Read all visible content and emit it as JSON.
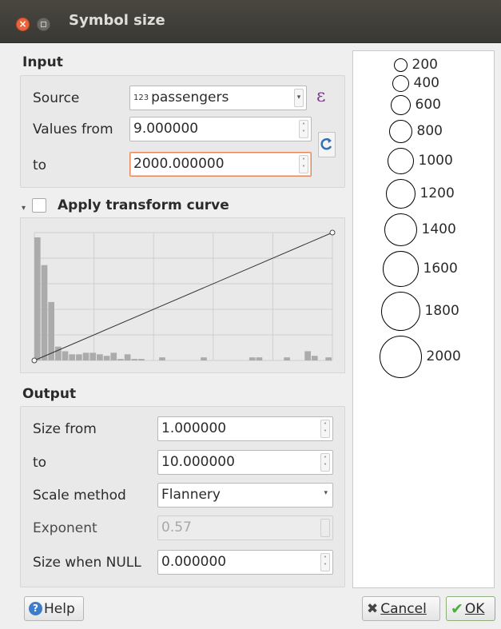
{
  "window": {
    "title": "Symbol size"
  },
  "input": {
    "section_title": "Input",
    "source_label": "Source",
    "source_type_badge": "123",
    "source_value": "passengers",
    "values_from_label": "Values from",
    "values_from": "9.000000",
    "to_label": "to",
    "to_value": "2000.000000",
    "expression_symbol": "ε"
  },
  "transform": {
    "label": "Apply transform curve",
    "checked": false
  },
  "output": {
    "section_title": "Output",
    "size_from_label": "Size from",
    "size_from": "1.000000",
    "to_label": "to",
    "to_value": "10.000000",
    "scale_method_label": "Scale method",
    "scale_method": "Flannery",
    "exponent_label": "Exponent",
    "exponent": "0.57",
    "size_null_label": "Size when NULL",
    "size_null": "0.000000"
  },
  "legend": {
    "items": [
      {
        "label": "200"
      },
      {
        "label": "400"
      },
      {
        "label": "600"
      },
      {
        "label": "800"
      },
      {
        "label": "1000"
      },
      {
        "label": "1200"
      },
      {
        "label": "1400"
      },
      {
        "label": "1600"
      },
      {
        "label": "1800"
      },
      {
        "label": "2000"
      }
    ]
  },
  "buttons": {
    "help": "Help",
    "cancel": "Cancel",
    "ok": "OK"
  },
  "histogram": {
    "bar_values": [
      80,
      62,
      38,
      9,
      6,
      4,
      4,
      5,
      5,
      4,
      3,
      5,
      1,
      4,
      1,
      1,
      0,
      0,
      2,
      0,
      0,
      0,
      0,
      0,
      2,
      0,
      0,
      0,
      0,
      0,
      0,
      2,
      2,
      0,
      0,
      0,
      2,
      0,
      0,
      6,
      3,
      0,
      2
    ],
    "curve": [
      [
        0,
        0
      ],
      [
        1,
        1
      ]
    ]
  },
  "colors": {
    "accent_focus": "#e3875a",
    "ok_check": "#4caf3c",
    "help_icon": "#3d7cc9",
    "refresh_icon": "#2f6fb8"
  }
}
